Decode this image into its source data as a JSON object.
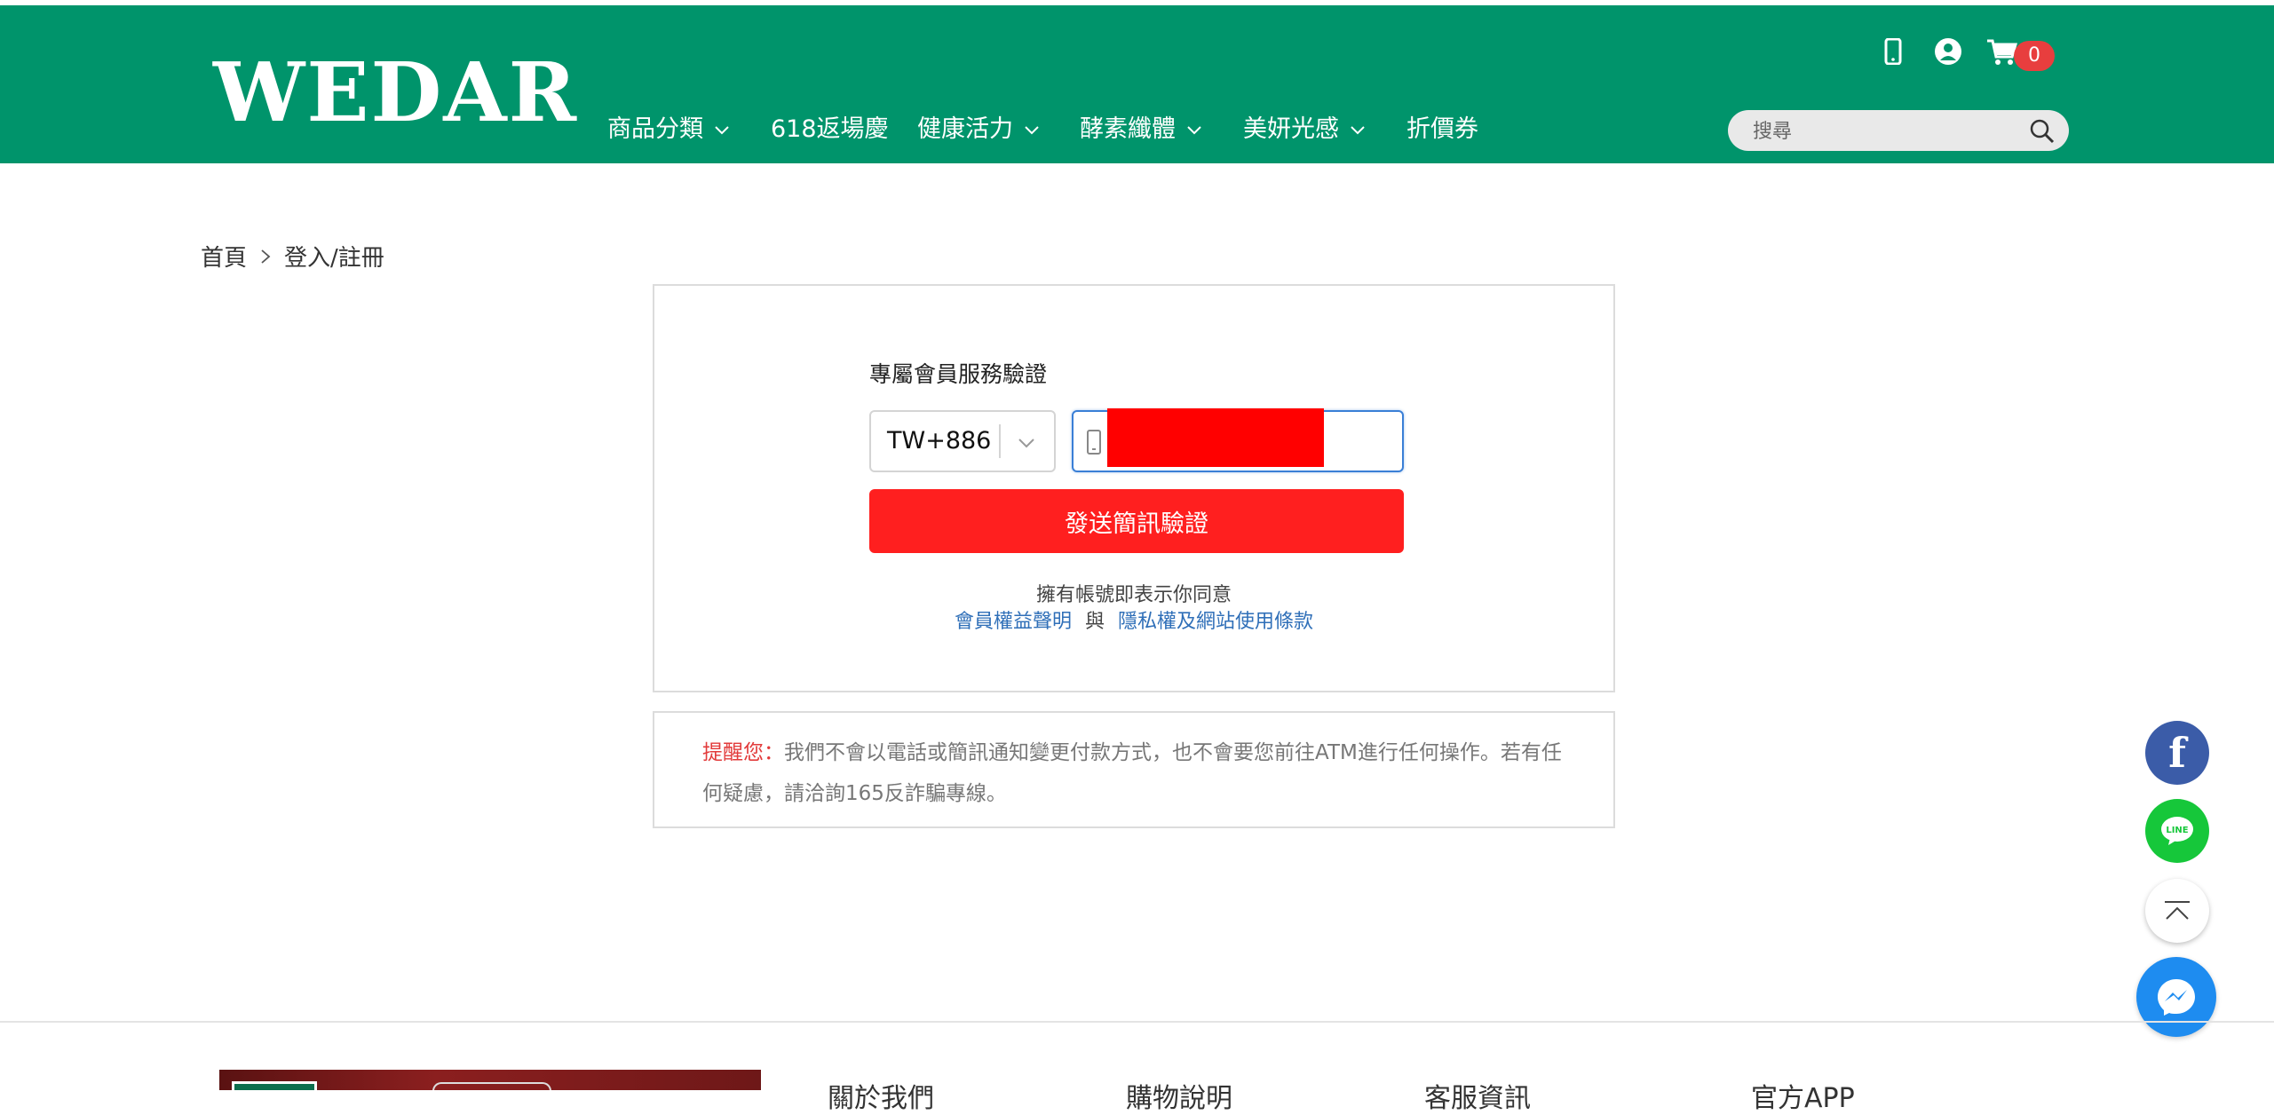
{
  "header": {
    "logo": "WEDAR",
    "nav": [
      {
        "label": "商品分類",
        "has_dropdown": true
      },
      {
        "label": "618返場慶",
        "has_dropdown": false
      },
      {
        "label": "健康活力",
        "has_dropdown": true
      },
      {
        "label": "酵素纖體",
        "has_dropdown": true
      },
      {
        "label": "美妍光感",
        "has_dropdown": true
      },
      {
        "label": "折價券",
        "has_dropdown": false
      }
    ],
    "icons": [
      "mobile-icon",
      "user-icon",
      "cart-icon"
    ],
    "cart_count": "0",
    "search_placeholder": "搜尋"
  },
  "breadcrumb": {
    "home": "首頁",
    "separator_icon": "chevron-right-icon",
    "current": "登入/註冊"
  },
  "login": {
    "title": "專屬會員服務驗證",
    "country_code": "TW+886",
    "phone_value": "",
    "send_button": "發送簡訊驗證",
    "agree_text": "擁有帳號即表示你同意",
    "link_member_rights": "會員權益聲明",
    "conjunction": "與",
    "link_privacy": "隱私權及網站使用條款"
  },
  "notice": {
    "lead": "提醒您：",
    "text": "我們不會以電話或簡訊通知變更付款方式，也不會要您前往ATM進行任何操作。若有任何疑慮，請洽詢165反詐騙專線。"
  },
  "floating": {
    "facebook_glyph": "f",
    "line_glyph": "LINE"
  },
  "footer": {
    "headings": [
      "關於我們",
      "購物說明",
      "客服資訊",
      "官方APP"
    ]
  },
  "colors": {
    "brand_green": "#00946b",
    "send_button_red": "#ff1f1f",
    "link_blue": "#2f6fb8",
    "notice_red": "#e23b3b",
    "cart_badge": "#e83e3e",
    "facebook": "#3b5ca8",
    "line": "#16c73a",
    "messenger": "#1e8cf0"
  }
}
